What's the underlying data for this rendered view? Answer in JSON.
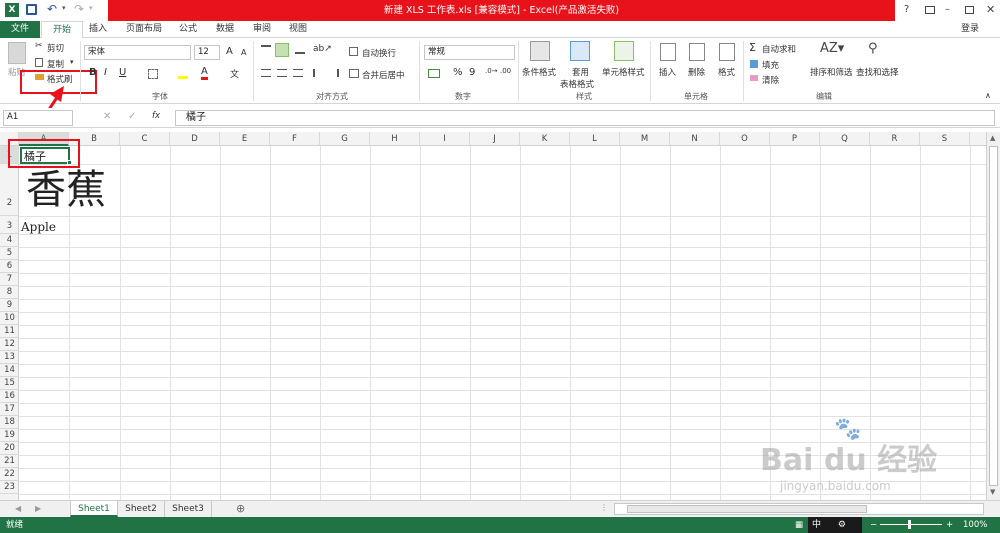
{
  "window": {
    "title": "新建 XLS 工作表.xls  [兼容模式] -  Excel(产品激活失败)",
    "login": "登录"
  },
  "tabs": [
    "文件",
    "开始",
    "插入",
    "页面布局",
    "公式",
    "数据",
    "审阅",
    "视图"
  ],
  "ribbon": {
    "clipboard": {
      "paste": "粘贴",
      "cut": "剪切",
      "copy": "复制",
      "format_painter": "格式刷",
      "label": "剪贴板"
    },
    "font": {
      "name": "宋体",
      "size": "12",
      "bold": "B",
      "italic": "I",
      "underline": "U",
      "label": "字体",
      "grow": "A",
      "shrink": "A",
      "font_color_glyph": "A"
    },
    "alignment": {
      "wrap": "自动换行",
      "merge": "合并后居中",
      "label": "对齐方式"
    },
    "number": {
      "format": "常规",
      "percent": "%",
      "comma": "9",
      "label": "数字"
    },
    "styles": {
      "conditional": "条件格式",
      "table_line1": "套用",
      "table_line2": "表格格式",
      "cell_styles": "单元格样式",
      "label": "样式"
    },
    "cells": {
      "insert": "插入",
      "delete": "删除",
      "format": "格式",
      "label": "单元格"
    },
    "editing": {
      "autosum": "自动求和",
      "fill": "填充",
      "clear": "清除",
      "sort": "排序和筛选",
      "find": "查找和选择",
      "label": "编辑"
    }
  },
  "formula_bar": {
    "name_box": "A1",
    "fx": "fx",
    "content": "橘子"
  },
  "columns": [
    "A",
    "B",
    "C",
    "D",
    "E",
    "F",
    "G",
    "H",
    "I",
    "J",
    "K",
    "L",
    "M",
    "N",
    "O",
    "P",
    "Q",
    "R",
    "S"
  ],
  "rows": [
    "1",
    "2",
    "3",
    "4",
    "5",
    "6",
    "7",
    "8",
    "9",
    "10",
    "11",
    "12",
    "13",
    "14",
    "15",
    "16",
    "17",
    "18",
    "19",
    "20",
    "21",
    "22",
    "23"
  ],
  "cells": {
    "A1": "橘子",
    "A2": "香蕉",
    "A3": "Apple"
  },
  "sheets": [
    "Sheet1",
    "Sheet2",
    "Sheet3"
  ],
  "status": {
    "ready": "就绪",
    "zoom": "100%",
    "ime_glyph": "中"
  },
  "watermark": {
    "line1": "Bai du 经验",
    "line2": "jingyan.baidu.com"
  },
  "colors": {
    "excel_green": "#217346",
    "title_red": "#e8121b",
    "highlight_red": "#e8121b"
  }
}
